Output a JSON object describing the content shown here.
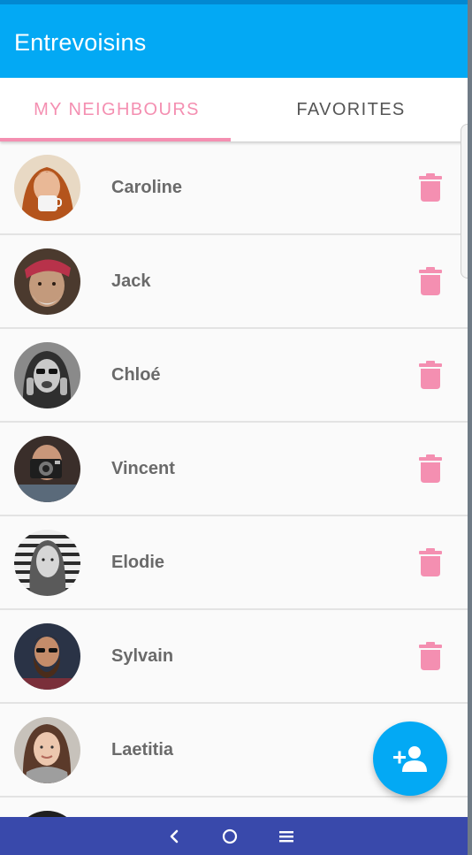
{
  "app": {
    "title": "Entrevoisins",
    "accent_color": "#03a9f4",
    "tab_accent_color": "#f48fb1"
  },
  "tabs": [
    {
      "label": "MY NEIGHBOURS",
      "selected": true
    },
    {
      "label": "FAVORITES",
      "selected": false
    }
  ],
  "neighbours": [
    {
      "name": "Caroline",
      "avatar": "caroline-photo",
      "delete_icon": "trash-icon"
    },
    {
      "name": "Jack",
      "avatar": "jack-photo",
      "delete_icon": "trash-icon"
    },
    {
      "name": "Chloé",
      "avatar": "chloe-photo",
      "delete_icon": "trash-icon"
    },
    {
      "name": "Vincent",
      "avatar": "vincent-photo",
      "delete_icon": "trash-icon"
    },
    {
      "name": "Elodie",
      "avatar": "elodie-photo",
      "delete_icon": "trash-icon"
    },
    {
      "name": "Sylvain",
      "avatar": "sylvain-photo",
      "delete_icon": "trash-icon"
    },
    {
      "name": "Laetitia",
      "avatar": "laetitia-photo",
      "delete_icon": "trash-icon"
    }
  ],
  "fab": {
    "icon": "add-person-icon"
  },
  "system_nav": {
    "back_icon": "back-chevron-icon",
    "home_icon": "home-circle-icon",
    "menu_icon": "menu-lines-icon"
  }
}
